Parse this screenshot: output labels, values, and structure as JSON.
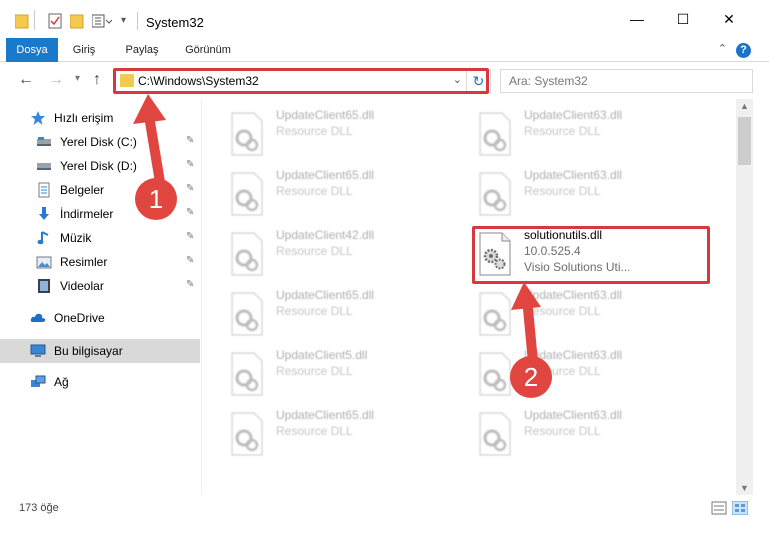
{
  "window": {
    "title": "System32",
    "minimize_glyph": "—",
    "maximize_glyph": "☐",
    "close_glyph": "✕"
  },
  "ribbon": {
    "tabs": [
      "Dosya",
      "Giriş",
      "Paylaş",
      "Görünüm"
    ],
    "active_tab": "Dosya",
    "help_glyph": "?",
    "collapse_glyph": "⌄"
  },
  "nav": {
    "back_glyph": "←",
    "forward_glyph": "→",
    "recent_glyph": "⌄",
    "up_glyph": "↑",
    "address": "C:\\Windows\\System32",
    "refresh_glyph": "↻",
    "dropdown_glyph": "⌄",
    "search_placeholder": "Ara: System32"
  },
  "sidebar": {
    "items": [
      {
        "label": "Hızlı erişim",
        "icon": "star-icon",
        "pinned": false
      },
      {
        "label": "Yerel Disk (C:)",
        "icon": "drive-icon",
        "pinned": true
      },
      {
        "label": "Yerel Disk (D:)",
        "icon": "drive-icon",
        "pinned": true
      },
      {
        "label": "Belgeler",
        "icon": "document-icon",
        "pinned": true
      },
      {
        "label": "İndirmeler",
        "icon": "download-icon",
        "pinned": true
      },
      {
        "label": "Müzik",
        "icon": "music-icon",
        "pinned": true
      },
      {
        "label": "Resimler",
        "icon": "pictures-icon",
        "pinned": true
      },
      {
        "label": "Videolar",
        "icon": "video-icon",
        "pinned": true
      },
      {
        "label": "OneDrive",
        "icon": "cloud-icon",
        "pinned": false
      },
      {
        "label": "Bu bilgisayar",
        "icon": "computer-icon",
        "pinned": false,
        "selected": true
      },
      {
        "label": "Ağ",
        "icon": "network-icon",
        "pinned": false
      }
    ],
    "pin_glyph": "📌"
  },
  "files": {
    "left_column": [
      {
        "name": "UpdateClient65.dll",
        "type": "Resource DLL"
      },
      {
        "name": "UpdateClient65.dll",
        "type": "Resource DLL"
      },
      {
        "name": "UpdateClient42.dll",
        "type": "Resource DLL"
      },
      {
        "name": "UpdateClient65.dll",
        "type": "Resource DLL"
      },
      {
        "name": "UpdateClient5.dll",
        "type": "Resource DLL"
      },
      {
        "name": "UpdateClient65.dll",
        "type": "Resource DLL"
      }
    ],
    "right_column": [
      {
        "name": "UpdateClient63.dll",
        "type": "Resource DLL"
      },
      {
        "name": "UpdateClient63.dll",
        "type": "Resource DLL"
      },
      {
        "name": "solutionutils.dll",
        "version": "10.0.525.4",
        "type": "Visio Solutions Uti...",
        "highlighted": true
      },
      {
        "name": "UpdateClient63.dll",
        "type": "Resource DLL"
      },
      {
        "name": "UpdateClient63.dll",
        "type": "Resource DLL"
      },
      {
        "name": "UpdateClient63.dll",
        "type": "Resource DLL"
      }
    ]
  },
  "status": {
    "item_count": "173 öğe"
  },
  "annotations": {
    "step1": "1",
    "step2": "2",
    "color": "#d9373f"
  }
}
